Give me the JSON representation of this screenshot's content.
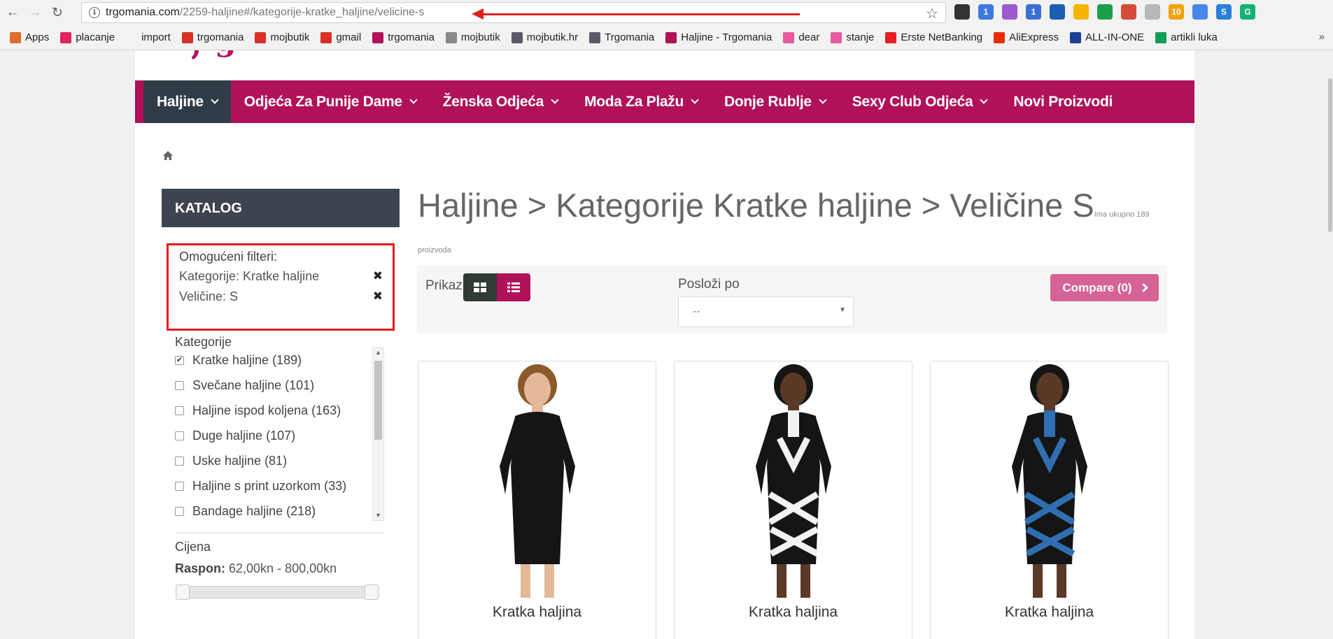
{
  "browser": {
    "url_domain": "trgomania.com",
    "url_path": "/2259-haljine#/kategorije-kratke_haljine/velicine-s"
  },
  "extensions": [
    {
      "icon": "ext-black-icon",
      "color": "#333333",
      "label": ""
    },
    {
      "icon": "ext-blue-doc-icon",
      "color": "#3d7ae0",
      "label": "1"
    },
    {
      "icon": "ext-pen-icon",
      "color": "#9b59d0",
      "label": ""
    },
    {
      "icon": "ext-code-icon",
      "color": "#3b6fd6",
      "label": "1"
    },
    {
      "icon": "ext-ai-icon",
      "color": "#1a5fb4",
      "label": ""
    },
    {
      "icon": "ext-smiley-icon",
      "color": "#f6b300",
      "label": ""
    },
    {
      "icon": "ext-drive-icon",
      "color": "#1e9e49",
      "label": ""
    },
    {
      "icon": "ext-globe-icon",
      "color": "#d64a3a",
      "label": ""
    },
    {
      "icon": "ext-camera-icon",
      "color": "#b8b8b8",
      "label": ""
    },
    {
      "icon": "ext-weather-icon",
      "color": "#f2a20c",
      "label": "10"
    },
    {
      "icon": "ext-translate-icon",
      "color": "#4a86e8",
      "label": ""
    },
    {
      "icon": "ext-s-icon",
      "color": "#2a7fd8",
      "label": "S"
    },
    {
      "icon": "ext-grammarly-icon",
      "color": "#15b371",
      "label": "G"
    }
  ],
  "bookmarks": [
    {
      "label": "Apps",
      "icon": "apps-grid-icon",
      "color": "#e06c2e"
    },
    {
      "label": "placanje",
      "icon": "d-icon",
      "color": "#e0245e"
    },
    {
      "label": "import",
      "icon": "blank-icon",
      "color": "#f2f2f2"
    },
    {
      "label": "trgomania",
      "icon": "gmail-icon",
      "color": "#d93025"
    },
    {
      "label": "mojbutik",
      "icon": "gmail-icon",
      "color": "#d93025"
    },
    {
      "label": "gmail",
      "icon": "gmail-icon",
      "color": "#d93025"
    },
    {
      "label": "trgomania",
      "icon": "t-icon",
      "color": "#b01159"
    },
    {
      "label": "mojbutik",
      "icon": "cart-icon",
      "color": "#888888"
    },
    {
      "label": "mojbutik.hr",
      "icon": "page-icon",
      "color": "#5a5a6a"
    },
    {
      "label": "Trgomania",
      "icon": "page-icon",
      "color": "#5a5a6a"
    },
    {
      "label": "Haljine - Trgomania",
      "icon": "t-icon",
      "color": "#b01159"
    },
    {
      "label": "dear",
      "icon": "flower-icon",
      "color": "#e85aa0"
    },
    {
      "label": "stanje",
      "icon": "flower-icon",
      "color": "#e85aa0"
    },
    {
      "label": "Erste NetBanking",
      "icon": "erste-icon",
      "color": "#e31e24"
    },
    {
      "label": "AliExpress",
      "icon": "ali-icon",
      "color": "#e62e04"
    },
    {
      "label": "ALL-IN-ONE",
      "icon": "17-icon",
      "color": "#1c3f94"
    },
    {
      "label": "artikli luka",
      "icon": "sheet-icon",
      "color": "#0f9d58"
    }
  ],
  "nav": {
    "items": [
      {
        "label": "Haljine",
        "caret": true,
        "active": true
      },
      {
        "label": "Odjeća Za Punije Dame",
        "caret": true
      },
      {
        "label": "Ženska Odjeća",
        "caret": true
      },
      {
        "label": "Moda Za Plažu",
        "caret": true
      },
      {
        "label": "Donje Rublje",
        "caret": true
      },
      {
        "label": "Sexy Club Odjeća",
        "caret": true
      },
      {
        "label": "Novi Proizvodi",
        "caret": false
      }
    ]
  },
  "sidebar": {
    "katalog": "KATALOG",
    "filters_title": "Omogućeni filteri:",
    "filters": [
      {
        "label": "Kategorije: Kratke haljine"
      },
      {
        "label": "Veličine: S"
      }
    ],
    "categories_title": "Kategorije",
    "categories": [
      {
        "label": "Kratke haljine (189)",
        "checked": true
      },
      {
        "label": "Svečane haljine (101)",
        "checked": false
      },
      {
        "label": "Haljine ispod koljena (163)",
        "checked": false
      },
      {
        "label": "Duge haljine (107)",
        "checked": false
      },
      {
        "label": "Uske haljine (81)",
        "checked": false
      },
      {
        "label": "Haljine s print uzorkom (33)",
        "checked": false
      },
      {
        "label": "Bandage haljine (218)",
        "checked": false
      }
    ],
    "price_title": "Cijena",
    "price_label": "Raspon:",
    "price_range": "62,00kn - 800,00kn"
  },
  "main": {
    "title": "Haljine > Kategorije Kratke haljine > Veličine S",
    "count_text": "Ima ukupno 189",
    "count_suffix": "proizvoda",
    "view_label": "Prikaz:",
    "sort_label": "Posloži po",
    "sort_value": "--",
    "compare_label": "Compare (0)",
    "products": [
      {
        "name": "Kratka haljina",
        "image": "dress-solid-black",
        "dress_color": "#151515",
        "accent": "#151515",
        "hair": "#8a5a2b",
        "skin": "#e3b99a"
      },
      {
        "name": "Kratka haljina",
        "image": "dress-black-white",
        "dress_color": "#151515",
        "accent": "#f2f2f2",
        "hair": "#151515",
        "skin": "#5a3a26"
      },
      {
        "name": "Kratka haljina",
        "image": "dress-black-blue",
        "dress_color": "#151515",
        "accent": "#2f6fb1",
        "hair": "#151515",
        "skin": "#5a3a26"
      }
    ]
  }
}
